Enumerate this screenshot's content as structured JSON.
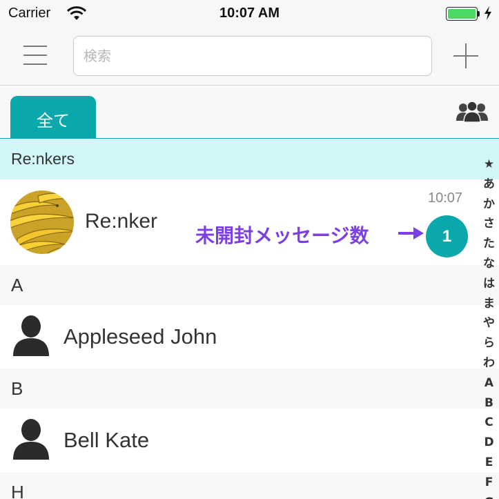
{
  "status_bar": {
    "carrier": "Carrier",
    "time": "10:07 AM",
    "wifi_icon": "wifi-icon",
    "battery_icon": "battery-icon",
    "battery_level": 1.0,
    "battery_color": "#4cd964"
  },
  "nav": {
    "menu_icon": "hamburger-menu-icon",
    "search_placeholder": "検索",
    "add_icon": "plus-icon"
  },
  "tabs": {
    "all_label": "全て",
    "group_icon": "group-people-icon",
    "accent_color": "#0aa7ab"
  },
  "list": {
    "group_section": "Re:nkers",
    "group_row": {
      "name": "Re:nker",
      "time": "10:07",
      "unread": "1",
      "annotation": "未開封メッセージ数"
    },
    "sections": [
      {
        "letter": "A",
        "contacts": [
          {
            "name": "Appleseed John"
          }
        ]
      },
      {
        "letter": "B",
        "contacts": [
          {
            "name": "Bell Kate"
          }
        ]
      },
      {
        "letter": "H",
        "contacts": []
      }
    ]
  },
  "index_bar": [
    "★",
    "あ",
    "か",
    "さ",
    "た",
    "な",
    "は",
    "ま",
    "や",
    "ら",
    "わ",
    "A",
    "B",
    "C",
    "D",
    "E",
    "F",
    "G"
  ]
}
